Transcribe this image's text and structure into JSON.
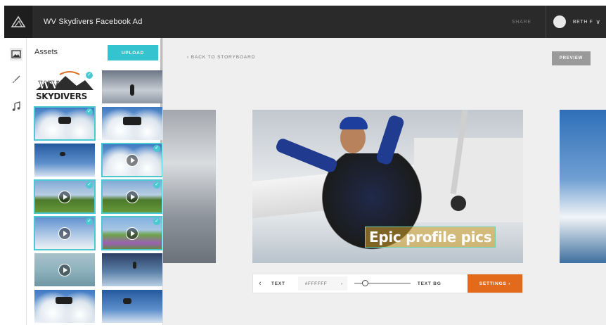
{
  "header": {
    "app_title": "WV Skydivers Facebook Ad",
    "share_label": "SHARE",
    "user_name": "BETH F",
    "user_chevron": "∨"
  },
  "sidebar": {
    "icons": [
      {
        "name": "image-icon",
        "active": true
      },
      {
        "name": "brush-icon",
        "active": false
      },
      {
        "name": "music-icon",
        "active": false
      }
    ]
  },
  "assets": {
    "title": "Assets",
    "upload_label": "UPLOAD",
    "logo_line1": "WV",
    "logo_line2": "SKYDIVERS",
    "items": [
      {
        "kind": "logo",
        "selected": true,
        "video": false
      },
      {
        "kind": "photo",
        "selected": false,
        "video": false
      },
      {
        "kind": "photo",
        "selected": true,
        "video": false
      },
      {
        "kind": "photo",
        "selected": false,
        "video": false
      },
      {
        "kind": "photo",
        "selected": false,
        "video": false
      },
      {
        "kind": "video",
        "selected": true,
        "video": true
      },
      {
        "kind": "video",
        "selected": true,
        "video": true
      },
      {
        "kind": "video",
        "selected": true,
        "video": true
      },
      {
        "kind": "video",
        "selected": true,
        "video": true
      },
      {
        "kind": "video",
        "selected": true,
        "video": true
      },
      {
        "kind": "video",
        "selected": false,
        "video": true
      },
      {
        "kind": "photo",
        "selected": false,
        "video": false
      },
      {
        "kind": "photo",
        "selected": false,
        "video": false
      },
      {
        "kind": "photo",
        "selected": false,
        "video": false
      }
    ]
  },
  "main": {
    "back_label": "‹  BACK TO STORYBOARD",
    "preview_label": "PREVIEW",
    "caption": "Epic profile pics"
  },
  "toolbar": {
    "prev_glyph": "‹",
    "text_label": "TEXT",
    "color_value": "#FFFFFF",
    "color_chevron": "›",
    "size_level": 0.15,
    "text_bg_label": "TEXT BG",
    "settings_label": "SETTINGS  ›"
  },
  "colors": {
    "accent": "#35c4cf",
    "settings": "#e26a1a",
    "topbar": "#2a2a2a"
  }
}
